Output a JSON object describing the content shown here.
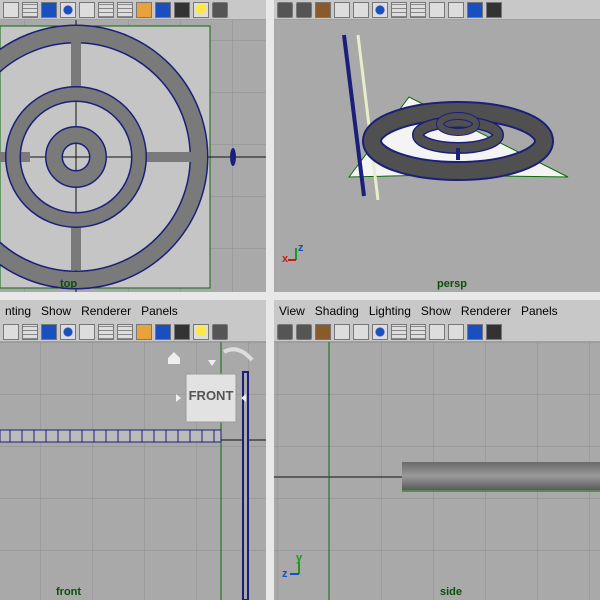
{
  "panes": {
    "top_left": {
      "label": "top"
    },
    "top_right": {
      "label": "persp",
      "axis_x": "x",
      "axis_y": "z"
    },
    "bottom_left": {
      "label": "front",
      "menu": [
        "nting",
        "Show",
        "Renderer",
        "Panels"
      ],
      "view_cube": "FRONT"
    },
    "bottom_right": {
      "label": "side",
      "menu": [
        "View",
        "Shading",
        "Lighting",
        "Show",
        "Renderer",
        "Panels"
      ],
      "axis_x": "z",
      "axis_y": "y"
    }
  },
  "colors": {
    "viewport_bg": "#a9a9a9",
    "grid": "#8f8f8f",
    "green_axis": "#0a6a0a",
    "mesh_fill": "#7a7a7a",
    "mesh_edge": "#1c1f7a",
    "selected_plane": "#f4f4f4"
  },
  "icons": [
    "cube-wire-icon",
    "grid-icon",
    "circle-icon",
    "cube-icon",
    "box-icon",
    "box-blue-icon",
    "box-dark-icon",
    "light-icon",
    "camera-icon",
    "texture-icon"
  ]
}
